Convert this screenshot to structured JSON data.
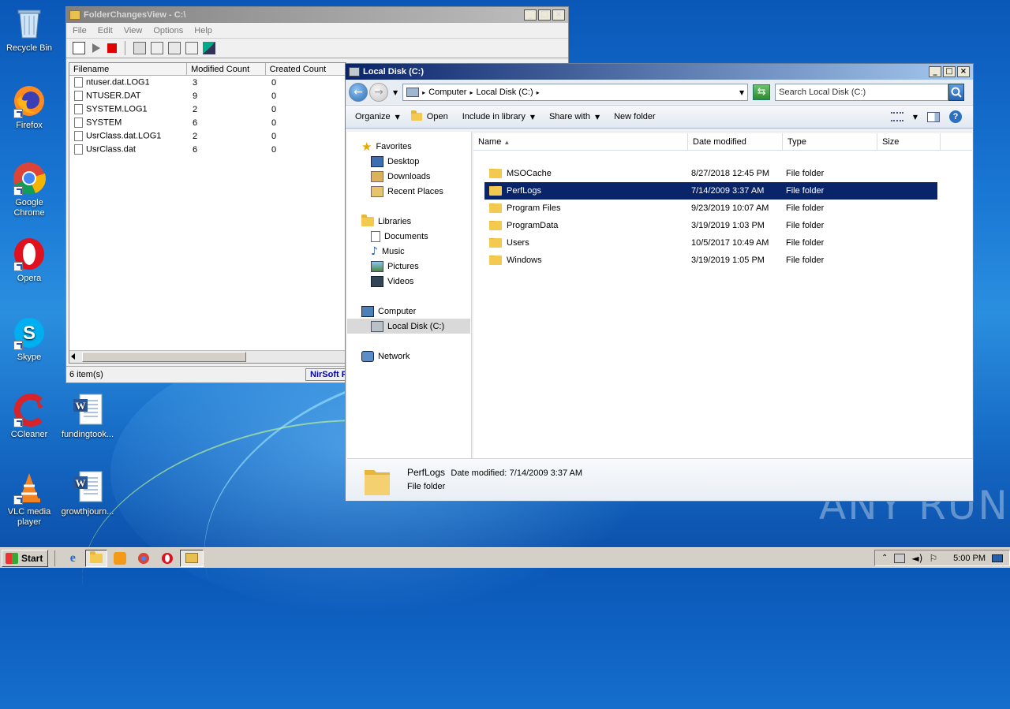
{
  "desktop": {
    "icons": [
      {
        "label": "Recycle Bin"
      },
      {
        "label": "Firefox"
      },
      {
        "label": "Google Chrome"
      },
      {
        "label": "Opera"
      },
      {
        "label": "Skype"
      },
      {
        "label": "CCleaner"
      },
      {
        "label": "fundingtook..."
      },
      {
        "label": "VLC media player"
      },
      {
        "label": "growthjourn..."
      }
    ],
    "watermark": "ANY RUN"
  },
  "fcv": {
    "title": "FolderChangesView  -  C:\\",
    "menu": [
      "File",
      "Edit",
      "View",
      "Options",
      "Help"
    ],
    "columns": [
      "Filename",
      "Modified Count",
      "Created Count"
    ],
    "rows": [
      {
        "name": "ntuser.dat.LOG1",
        "modified": "3",
        "created": "0"
      },
      {
        "name": "NTUSER.DAT",
        "modified": "9",
        "created": "0"
      },
      {
        "name": "SYSTEM.LOG1",
        "modified": "2",
        "created": "0"
      },
      {
        "name": "SYSTEM",
        "modified": "6",
        "created": "0"
      },
      {
        "name": "UsrClass.dat.LOG1",
        "modified": "2",
        "created": "0"
      },
      {
        "name": "UsrClass.dat",
        "modified": "6",
        "created": "0"
      }
    ],
    "status": "6 item(s)",
    "brand": "NirSoft F"
  },
  "explorer": {
    "title": "Local Disk (C:)",
    "breadcrumb": [
      "Computer",
      "Local Disk (C:)"
    ],
    "search_placeholder": "Search Local Disk (C:)",
    "commands": [
      "Organize",
      "Open",
      "Include in library",
      "Share with",
      "New folder"
    ],
    "nav": {
      "favorites": "Favorites",
      "favorites_items": [
        "Desktop",
        "Downloads",
        "Recent Places"
      ],
      "libraries": "Libraries",
      "libraries_items": [
        "Documents",
        "Music",
        "Pictures",
        "Videos"
      ],
      "computer": "Computer",
      "computer_items": [
        "Local Disk (C:)"
      ],
      "network": "Network"
    },
    "columns": [
      "Name",
      "Date modified",
      "Type",
      "Size"
    ],
    "rows": [
      {
        "name": "MSOCache",
        "date": "8/27/2018 12:45 PM",
        "type": "File folder",
        "selected": false
      },
      {
        "name": "PerfLogs",
        "date": "7/14/2009 3:37 AM",
        "type": "File folder",
        "selected": true
      },
      {
        "name": "Program Files",
        "date": "9/23/2019 10:07 AM",
        "type": "File folder",
        "selected": false
      },
      {
        "name": "ProgramData",
        "date": "3/19/2019 1:03 PM",
        "type": "File folder",
        "selected": false
      },
      {
        "name": "Users",
        "date": "10/5/2017 10:49 AM",
        "type": "File folder",
        "selected": false
      },
      {
        "name": "Windows",
        "date": "3/19/2019 1:05 PM",
        "type": "File folder",
        "selected": false
      }
    ],
    "details": {
      "name": "PerfLogs",
      "date_label": "Date modified:",
      "date": "7/14/2009 3:37 AM",
      "type": "File folder"
    }
  },
  "taskbar": {
    "start": "Start",
    "clock": "5:00 PM"
  }
}
